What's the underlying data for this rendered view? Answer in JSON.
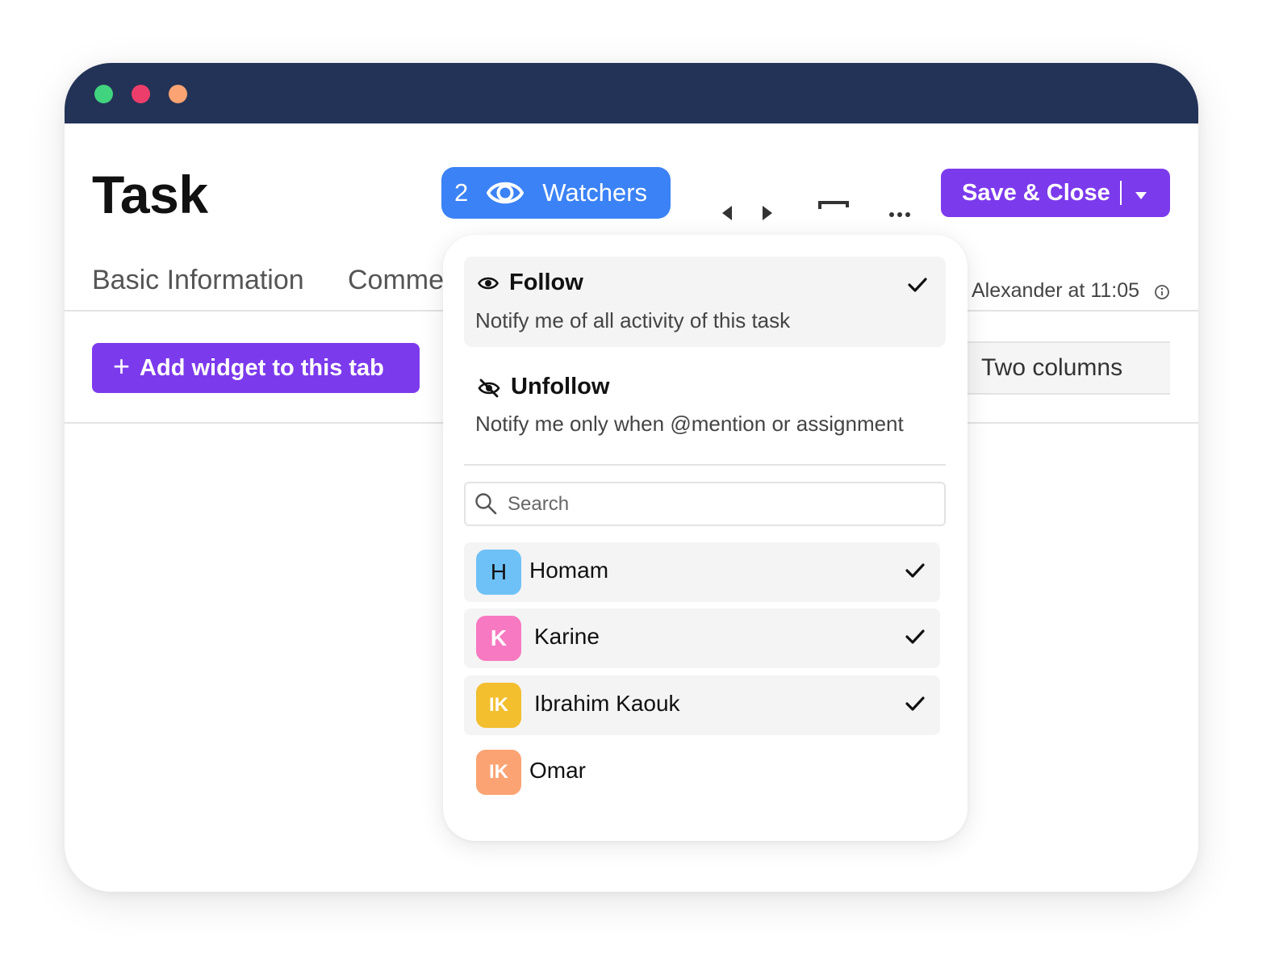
{
  "window": {
    "traffic_lights": [
      {
        "name": "green-dot",
        "color": "#40d47e"
      },
      {
        "name": "red-dot",
        "color": "#ed3e6b"
      },
      {
        "name": "orange-dot",
        "color": "#fba373"
      }
    ],
    "titlebar_color": "#233357"
  },
  "header": {
    "title": "Task",
    "watchers": {
      "count": "2",
      "label": "Watchers",
      "icon": "eye-icon",
      "color": "#3b82f6"
    },
    "toolbar_icons": [
      "prev-arrow-icon",
      "next-arrow-icon",
      "panel-icon",
      "more-options-icon"
    ],
    "save_label": "Save & Close",
    "save_color": "#7c3aed"
  },
  "tabs": [
    {
      "label": "Basic Information"
    },
    {
      "label": "Comments"
    }
  ],
  "updated_text": "Alexander at 11:05",
  "content": {
    "add_widget_label": "Add widget to this tab",
    "layout_option": "Two columns"
  },
  "watch_menu": {
    "options": [
      {
        "title": "Follow",
        "description": "Notify me of all activity of this task",
        "icon": "eye-icon",
        "checked": true
      },
      {
        "title": "Unfollow",
        "description": "Notify me only when @mention or assignment",
        "icon": "eye-off-icon",
        "checked": false
      }
    ],
    "search": {
      "placeholder": "Search",
      "value": ""
    },
    "users": [
      {
        "initials": "H",
        "name": "Homam",
        "color": "#6ec1f7",
        "checked": true
      },
      {
        "initials": "K",
        "name": "Karine",
        "color": "#f779c1",
        "checked": true
      },
      {
        "initials": "IK",
        "name": "Ibrahim Kaouk",
        "color": "#f3bf2f",
        "checked": true
      },
      {
        "initials": "IK",
        "name": "Omar",
        "color": "#fba373",
        "checked": false
      }
    ]
  }
}
